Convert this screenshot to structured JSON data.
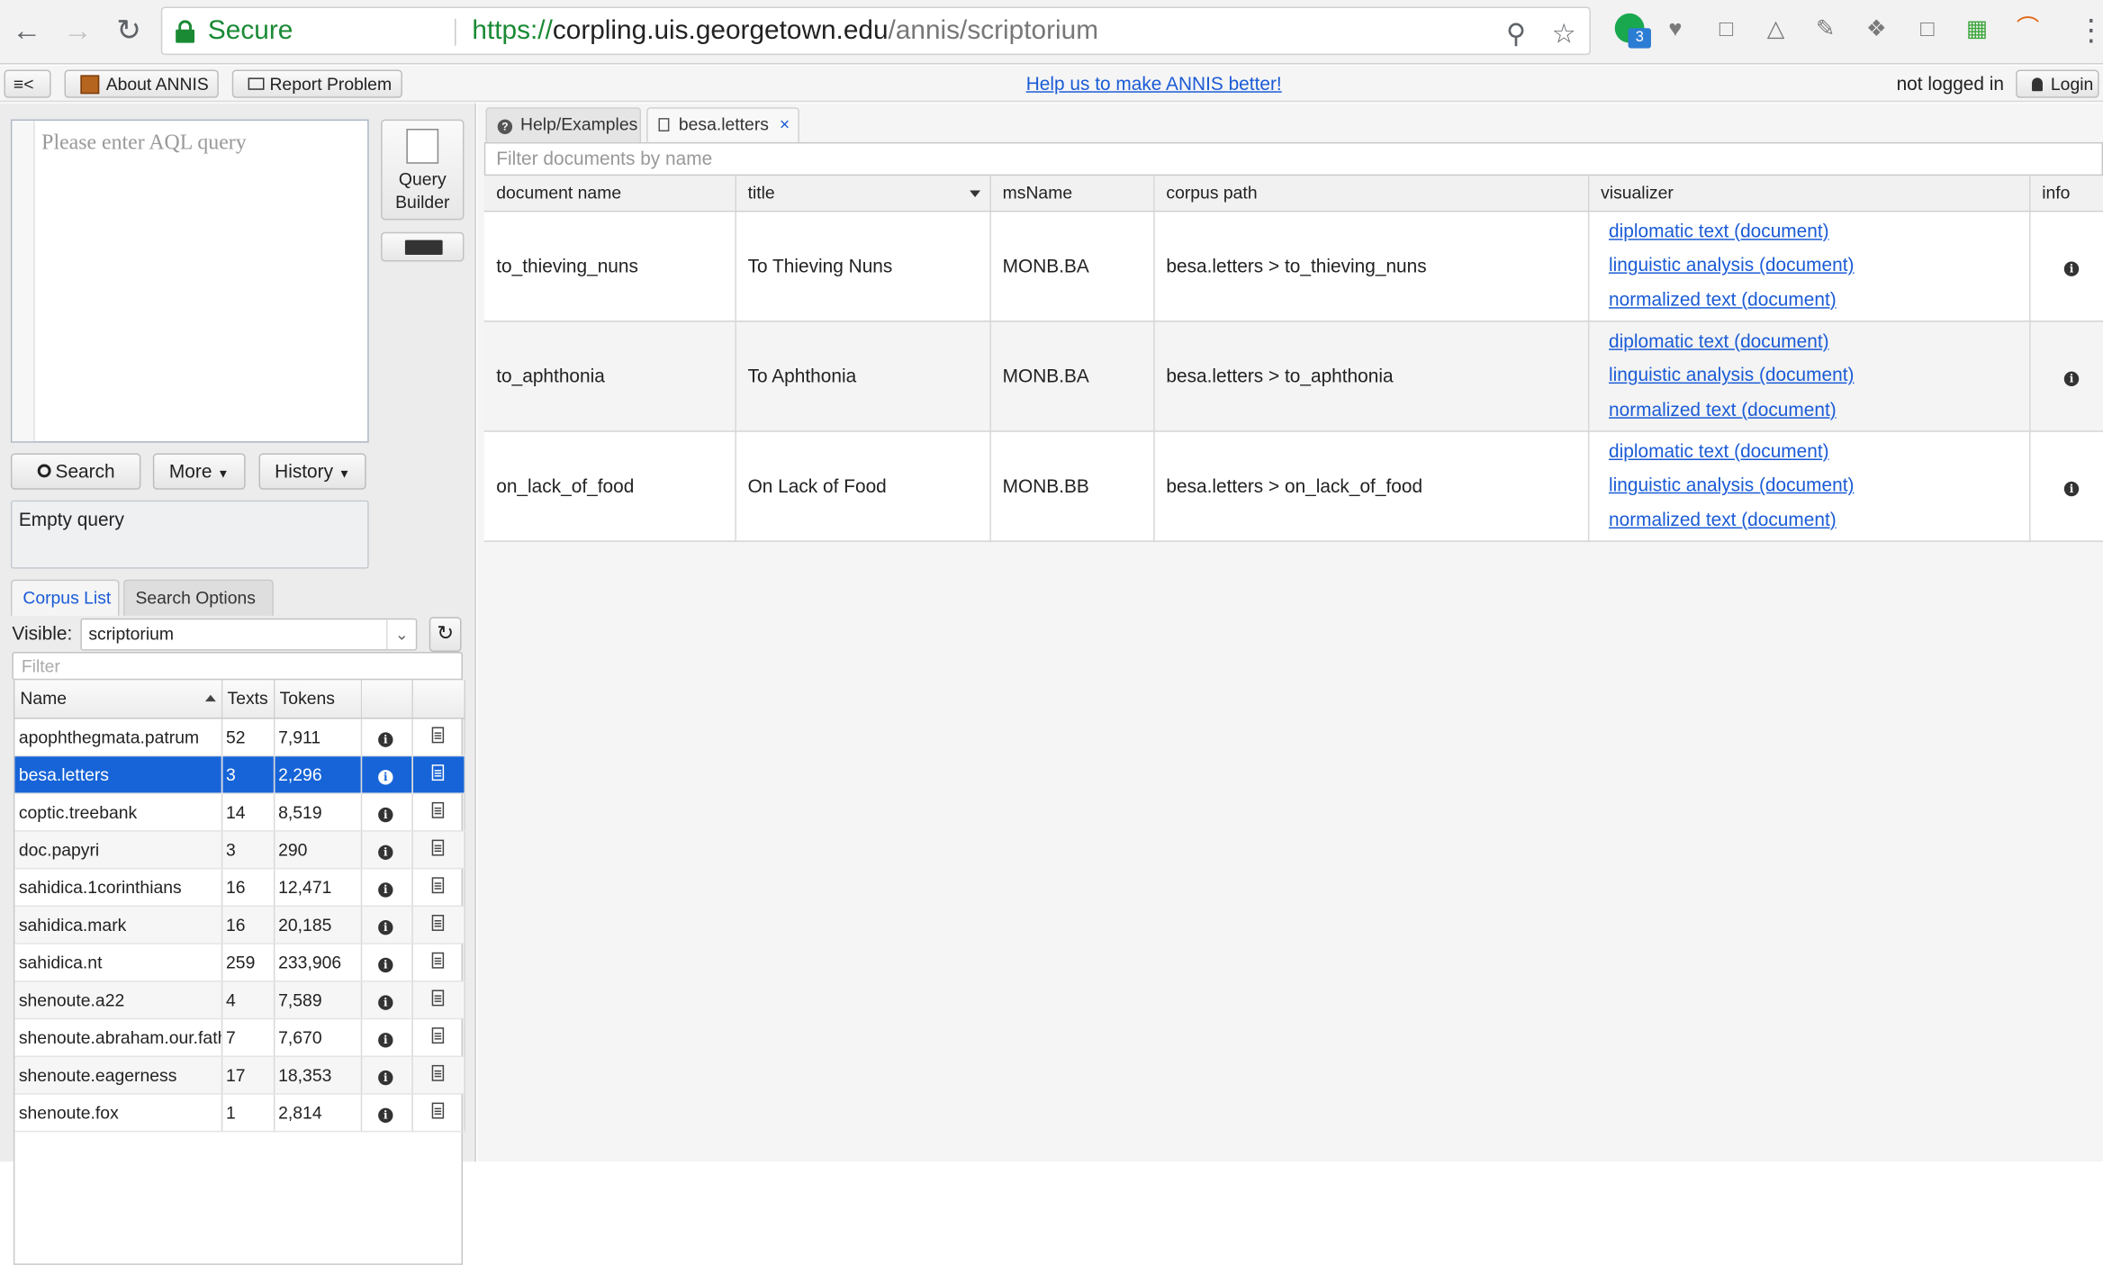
{
  "browser": {
    "secure_label": "Secure",
    "url_scheme": "https://",
    "url_host": "corpling.uis.georgetown.edu",
    "url_path": "/annis/scriptorium",
    "extension_badge": "3"
  },
  "appbar": {
    "toggle_label": "≡<",
    "about_label": "About ANNIS",
    "report_label": "Report Problem",
    "help_link": "Help us to make ANNIS better!",
    "login_status": "not logged in",
    "login_label": "Login"
  },
  "query": {
    "placeholder": "Please enter AQL query",
    "builder_label_1": "Query",
    "builder_label_2": "Builder",
    "search_label": "Search",
    "more_label": "More",
    "history_label": "History",
    "status_text": "Empty query"
  },
  "left_tabs": {
    "corpus_list": "Corpus List",
    "search_options": "Search Options"
  },
  "corpus": {
    "visible_label": "Visible:",
    "visible_value": "scriptorium",
    "filter_placeholder": "Filter",
    "headers": [
      "Name",
      "Texts",
      "Tokens"
    ],
    "selected_index": 1,
    "rows": [
      {
        "name": "apophthegmata.patrum",
        "texts": "52",
        "tokens": "7,911"
      },
      {
        "name": "besa.letters",
        "texts": "3",
        "tokens": "2,296"
      },
      {
        "name": "coptic.treebank",
        "texts": "14",
        "tokens": "8,519"
      },
      {
        "name": "doc.papyri",
        "texts": "3",
        "tokens": "290"
      },
      {
        "name": "sahidica.1corinthians",
        "texts": "16",
        "tokens": "12,471"
      },
      {
        "name": "sahidica.mark",
        "texts": "16",
        "tokens": "20,185"
      },
      {
        "name": "sahidica.nt",
        "texts": "259",
        "tokens": "233,906"
      },
      {
        "name": "shenoute.a22",
        "texts": "4",
        "tokens": "7,589"
      },
      {
        "name": "shenoute.abraham.our.fath",
        "texts": "7",
        "tokens": "7,670"
      },
      {
        "name": "shenoute.eagerness",
        "texts": "17",
        "tokens": "18,353"
      },
      {
        "name": "shenoute.fox",
        "texts": "1",
        "tokens": "2,814"
      }
    ]
  },
  "right_tabs": {
    "help": "Help/Examples",
    "doc": "besa.letters",
    "close": "×"
  },
  "documents": {
    "filter_placeholder": "Filter documents by name",
    "headers": [
      "document name",
      "title",
      "msName",
      "corpus path",
      "visualizer",
      "info"
    ],
    "visualizers": [
      "diplomatic text (document)",
      "linguistic analysis (document)",
      "normalized text (document)"
    ],
    "rows": [
      {
        "name": "to_thieving_nuns",
        "title": "To Thieving Nuns",
        "msname": "MONB.BA",
        "path": "besa.letters > to_thieving_nuns"
      },
      {
        "name": "to_aphthonia",
        "title": "To Aphthonia",
        "msname": "MONB.BA",
        "path": "besa.letters > to_aphthonia"
      },
      {
        "name": "on_lack_of_food",
        "title": "On Lack of Food",
        "msname": "MONB.BB",
        "path": "besa.letters > on_lack_of_food"
      }
    ]
  },
  "colors": {
    "secure_green": "#1a8a34",
    "link_blue": "#1a5bd6",
    "selection_blue": "#1764d8"
  }
}
